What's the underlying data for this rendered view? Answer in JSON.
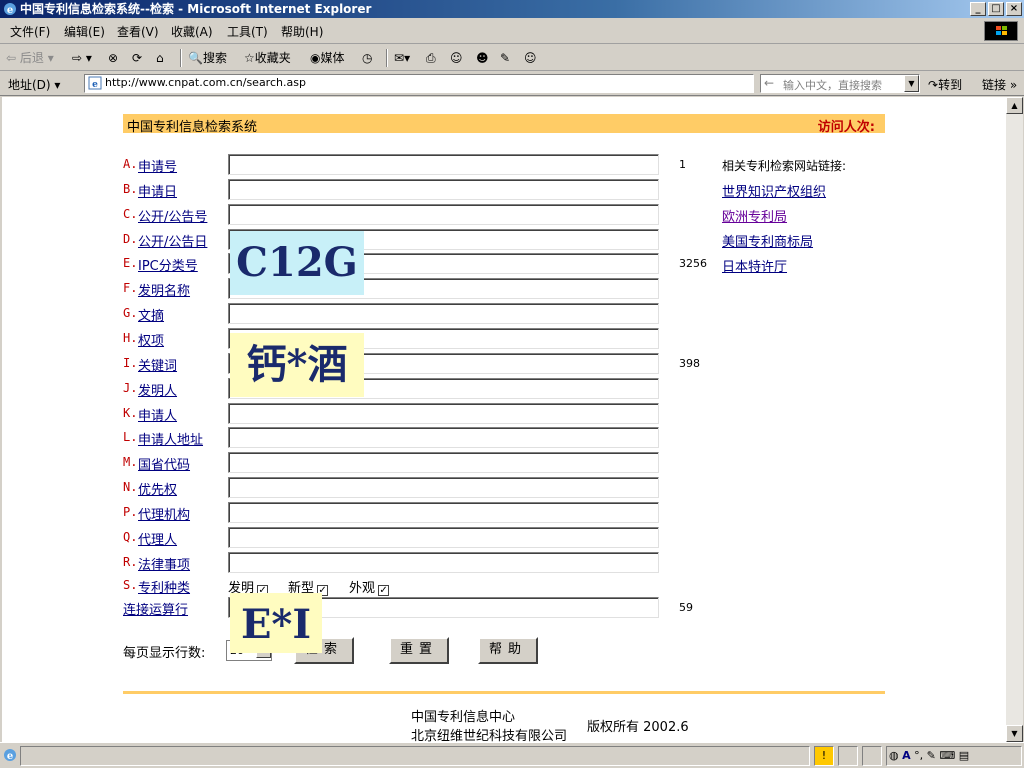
{
  "window": {
    "title": "中国专利信息检索系统--检索 - Microsoft Internet Explorer",
    "min": "_",
    "max": "□",
    "close": "×"
  },
  "menu": [
    "文件(F)",
    "编辑(E)",
    "查看(V)",
    "收藏(A)",
    "工具(T)",
    "帮助(H)"
  ],
  "toolbar": {
    "back": "后退",
    "search": "搜索",
    "favorites": "收藏夹",
    "media": "媒体"
  },
  "address": {
    "label": "地址(D)",
    "url": "http://www.cnpat.com.cn/search.asp",
    "hint": "输入中文，直接搜索",
    "go": "转到",
    "links": "链接"
  },
  "page": {
    "site_title": "中国专利信息检索系统",
    "visit_label": "访问人次:",
    "fields": [
      {
        "letter": "A.",
        "label": "申请号",
        "count": "1"
      },
      {
        "letter": "B.",
        "label": "申请日",
        "count": ""
      },
      {
        "letter": "C.",
        "label": "公开/公告号",
        "count": ""
      },
      {
        "letter": "D.",
        "label": "公开/公告日",
        "count": ""
      },
      {
        "letter": "E.",
        "label": "IPC分类号",
        "count": "3256"
      },
      {
        "letter": "F.",
        "label": "发明名称",
        "count": ""
      },
      {
        "letter": "G.",
        "label": "文摘",
        "count": ""
      },
      {
        "letter": "H.",
        "label": "权项",
        "count": ""
      },
      {
        "letter": "I.",
        "label": "关键词",
        "count": "398"
      },
      {
        "letter": "J.",
        "label": "发明人",
        "count": ""
      },
      {
        "letter": "K.",
        "label": "申请人",
        "count": ""
      },
      {
        "letter": "L.",
        "label": "申请人地址",
        "count": ""
      },
      {
        "letter": "M.",
        "label": "国省代码",
        "count": ""
      },
      {
        "letter": "N.",
        "label": "优先权",
        "count": ""
      },
      {
        "letter": "P.",
        "label": "代理机构",
        "count": ""
      },
      {
        "letter": "Q.",
        "label": "代理人",
        "count": ""
      },
      {
        "letter": "R.",
        "label": "法律事项",
        "count": ""
      }
    ],
    "patent_type": {
      "letter": "S.",
      "label": "专利种类",
      "options": [
        {
          "label": "发明",
          "checked": true
        },
        {
          "label": "新型",
          "checked": true
        },
        {
          "label": "外观",
          "checked": true
        }
      ]
    },
    "logic_row": {
      "label": "连接运算行",
      "count": "59"
    },
    "perpage": {
      "label": "每页显示行数:",
      "value": "20"
    },
    "buttons": {
      "search": "检索",
      "reset": "重置",
      "help": "帮助"
    },
    "related": {
      "title": "相关专利检索网站链接:",
      "links": [
        "世界知识产权组织",
        "欧洲专利局",
        "美国专利商标局",
        "日本特许厅"
      ]
    },
    "footer": {
      "org1": "中国专利信息中心",
      "org2": "北京纽维世纪科技有限公司",
      "copyright": "版权所有 2002.6"
    },
    "overlays": {
      "ipc": "C12G",
      "keyword": "钙*酒",
      "logic": "E*I"
    }
  },
  "colors": {
    "header_bar": "#ffcc66",
    "field_letter": "#c00000",
    "link": "#000080",
    "visited_link": "#660099",
    "overlay_cyan": "#c8f0f8",
    "overlay_yellow": "#fffcc0"
  }
}
